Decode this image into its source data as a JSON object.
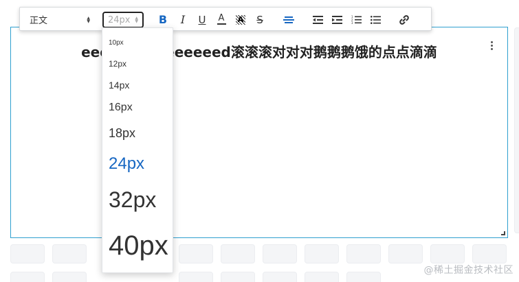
{
  "toolbar": {
    "heading_select": {
      "value": "正文"
    },
    "font_size_select": {
      "value": "24px"
    },
    "icons": [
      "bold-icon",
      "italic-icon",
      "underline-icon",
      "font-color-icon",
      "background-color-icon",
      "strikethrough-icon",
      "align-center-icon",
      "indent-decrease-icon",
      "indent-increase-icon",
      "ordered-list-icon",
      "unordered-list-icon",
      "link-icon"
    ],
    "labels": {
      "bold": "B",
      "italic": "I",
      "underline": "U",
      "color": "A",
      "bg": "A",
      "strike": "S"
    }
  },
  "dropdown": {
    "options": [
      {
        "label": "10px",
        "selected": false
      },
      {
        "label": "12px",
        "selected": false
      },
      {
        "label": "14px",
        "selected": false
      },
      {
        "label": "16px",
        "selected": false
      },
      {
        "label": "18px",
        "selected": false
      },
      {
        "label": "24px",
        "selected": true
      },
      {
        "label": "32px",
        "selected": false
      },
      {
        "label": "40px",
        "selected": false
      }
    ]
  },
  "editor": {
    "content": "eeeeeeeeeeeeeeed滚滚滚对对对鹅鹅鹅饿的点点滴滴"
  },
  "watermark": "@稀土掘金技术社区",
  "colors": {
    "accent": "#1767c2",
    "editor_border": "#2d9fcf"
  }
}
